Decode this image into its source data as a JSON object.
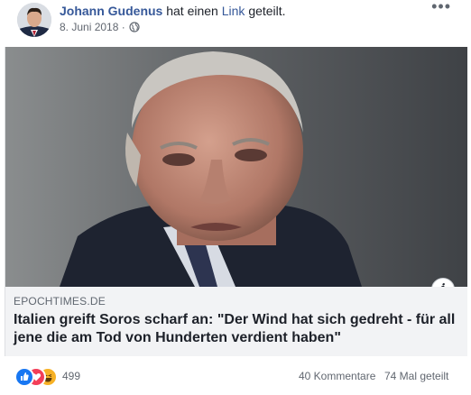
{
  "post": {
    "author": "Johann Gudenus",
    "action_prefix": "hat einen",
    "action_link": "Link",
    "action_suffix": "geteilt.",
    "date": "8. Juni 2018",
    "separator": "·",
    "privacy_icon": "globe-icon",
    "more_icon": "more-options-icon"
  },
  "link_card": {
    "domain": "EPOCHTIMES.DE",
    "headline": "Italien greift Soros scharf an: \"Der Wind hat sich gedreht - für all jene die am Tod von Hunderten verdient haben\"",
    "info_icon": "i"
  },
  "stats": {
    "reactions_count": "499",
    "reaction_icons": [
      "like-icon",
      "love-icon",
      "haha-icon"
    ],
    "comments": "40 Kommentare",
    "shares": "74 Mal geteilt"
  },
  "colors": {
    "link_blue": "#365899",
    "like_blue": "#1877f2",
    "love_red": "#f33e58",
    "haha_yellow": "#f7b125",
    "caption_bg": "#f2f3f5"
  }
}
